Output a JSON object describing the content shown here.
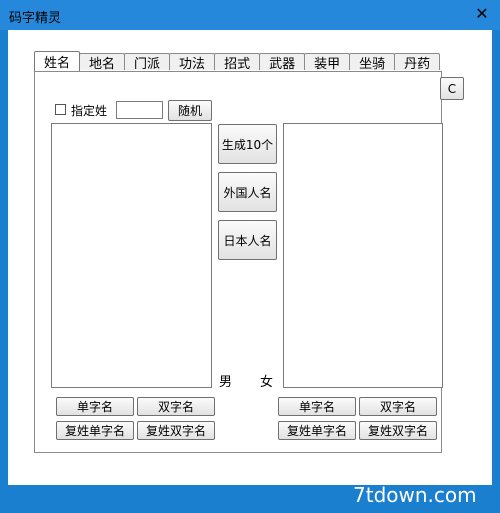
{
  "window": {
    "title": "码字精灵",
    "close_glyph": "✕"
  },
  "tabs": [
    {
      "label": "姓名",
      "active": true
    },
    {
      "label": "地名",
      "active": false
    },
    {
      "label": "门派",
      "active": false
    },
    {
      "label": "功法",
      "active": false
    },
    {
      "label": "招式",
      "active": false
    },
    {
      "label": "武器",
      "active": false
    },
    {
      "label": "装甲",
      "active": false
    },
    {
      "label": "坐骑",
      "active": false
    },
    {
      "label": "丹药",
      "active": false
    }
  ],
  "surname_panel": {
    "specify_surname_label": "指定姓",
    "specify_surname_checked": false,
    "surname_value": "",
    "random_button": "随机",
    "copy_button": "C",
    "generate_button": "生成10个",
    "foreign_button": "外国人名",
    "japanese_button": "日本人名",
    "male_label": "男",
    "female_label": "女",
    "male_buttons": {
      "single": "单字名",
      "double": "双字名",
      "compound_single": "复姓单字名",
      "compound_double": "复姓双字名"
    },
    "female_buttons": {
      "single": "单字名",
      "double": "双字名",
      "compound_single": "复姓单字名",
      "compound_double": "复姓双字名"
    }
  },
  "watermark": "7tdown.com"
}
